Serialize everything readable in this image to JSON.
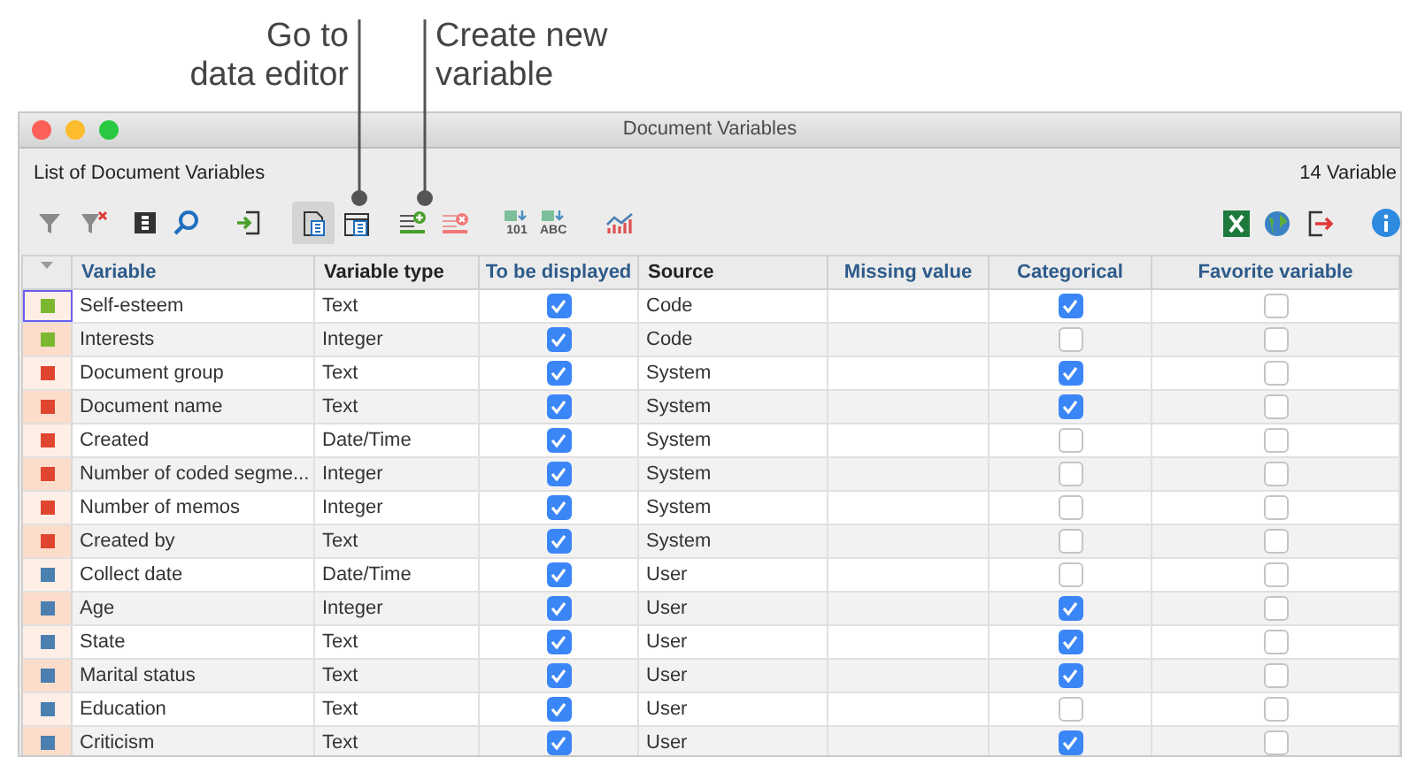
{
  "callouts": [
    {
      "lines": [
        "Go to",
        "data editor"
      ]
    },
    {
      "lines": [
        "Create new",
        "variable"
      ]
    }
  ],
  "window": {
    "title": "Document Variables"
  },
  "heading": "List of Document Variables",
  "count": "14 Variable",
  "view_toggle": [
    {
      "selected": true
    },
    {
      "selected": false
    }
  ],
  "convert_labels": [
    "101",
    "ABC"
  ],
  "columns": [
    {
      "label": "Variable",
      "editable": true
    },
    {
      "label": "Variable type",
      "editable": false
    },
    {
      "label": "To be displayed",
      "editable": true
    },
    {
      "label": "Source",
      "editable": false
    },
    {
      "label": "Missing value",
      "editable": true
    },
    {
      "label": "Categorical",
      "editable": true
    },
    {
      "label": "Favorite variable",
      "editable": true
    }
  ],
  "rows": [
    {
      "name": "Self-esteem",
      "type": "Text",
      "displayed": true,
      "source": "Code",
      "categorical": true,
      "favorite": false,
      "color": "#7cb82f",
      "selected": true
    },
    {
      "name": "Interests",
      "type": "Integer",
      "displayed": true,
      "source": "Code",
      "categorical": false,
      "favorite": false,
      "color": "#7cb82f",
      "selected": false
    },
    {
      "name": "Document group",
      "type": "Text",
      "displayed": true,
      "source": "System",
      "categorical": true,
      "favorite": false,
      "color": "#e0452f",
      "selected": false
    },
    {
      "name": "Document name",
      "type": "Text",
      "displayed": true,
      "source": "System",
      "categorical": true,
      "favorite": false,
      "color": "#e0452f",
      "selected": false
    },
    {
      "name": "Created",
      "type": "Date/Time",
      "displayed": true,
      "source": "System",
      "categorical": false,
      "favorite": false,
      "color": "#e0452f",
      "selected": false
    },
    {
      "name": "Number of coded segme...",
      "type": "Integer",
      "displayed": true,
      "source": "System",
      "categorical": false,
      "favorite": false,
      "color": "#e0452f",
      "selected": false
    },
    {
      "name": "Number of memos",
      "type": "Integer",
      "displayed": true,
      "source": "System",
      "categorical": false,
      "favorite": false,
      "color": "#e0452f",
      "selected": false
    },
    {
      "name": "Created by",
      "type": "Text",
      "displayed": true,
      "source": "System",
      "categorical": false,
      "favorite": false,
      "color": "#e0452f",
      "selected": false
    },
    {
      "name": "Collect date",
      "type": "Date/Time",
      "displayed": true,
      "source": "User",
      "categorical": false,
      "favorite": false,
      "color": "#4a7fb0",
      "selected": false
    },
    {
      "name": "Age",
      "type": "Integer",
      "displayed": true,
      "source": "User",
      "categorical": true,
      "favorite": false,
      "color": "#4a7fb0",
      "selected": false
    },
    {
      "name": "State",
      "type": "Text",
      "displayed": true,
      "source": "User",
      "categorical": true,
      "favorite": false,
      "color": "#4a7fb0",
      "selected": false
    },
    {
      "name": "Marital status",
      "type": "Text",
      "displayed": true,
      "source": "User",
      "categorical": true,
      "favorite": false,
      "color": "#4a7fb0",
      "selected": false
    },
    {
      "name": "Education",
      "type": "Text",
      "displayed": true,
      "source": "User",
      "categorical": false,
      "favorite": false,
      "color": "#4a7fb0",
      "selected": false
    },
    {
      "name": "Criticism",
      "type": "Text",
      "displayed": true,
      "source": "User",
      "categorical": true,
      "favorite": false,
      "color": "#4a7fb0",
      "selected": false
    }
  ]
}
